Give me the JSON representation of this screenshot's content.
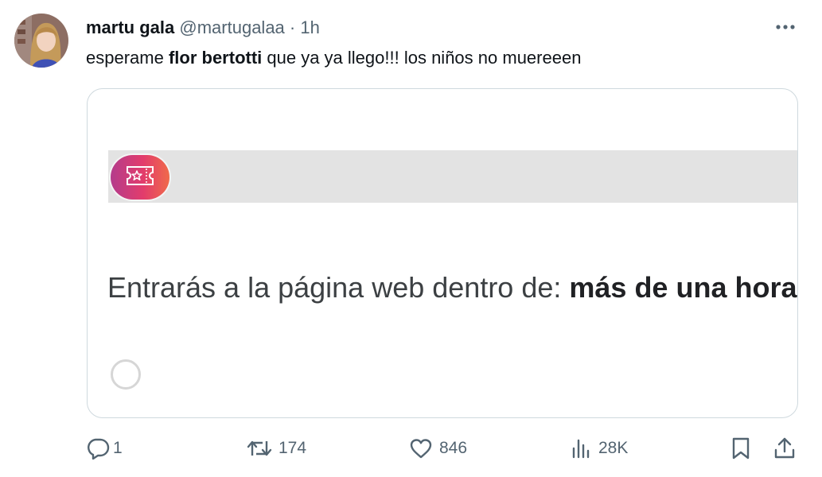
{
  "tweet": {
    "author_name": "martu gala",
    "author_handle": "@martugalaa",
    "separator": "·",
    "time": "1h",
    "text_before": "esperame ",
    "text_mention": "flor bertotti",
    "text_after": " que ya ya llego!!! los niños no muereeen"
  },
  "card": {
    "message_prefix": "Entrarás a la página web dentro de: ",
    "message_value": "más de una hora"
  },
  "actions": {
    "reply_count": "1",
    "retweet_count": "174",
    "like_count": "846",
    "views_count": "28K"
  },
  "icons": {
    "more": "more-icon",
    "reply": "reply-icon",
    "retweet": "retweet-icon",
    "like": "heart-icon",
    "views": "views-icon",
    "bookmark": "bookmark-icon",
    "share": "share-icon",
    "ticket": "ticket-icon"
  },
  "colors": {
    "text_primary": "#0f1419",
    "text_secondary": "#536471",
    "card_border": "#cfd9de",
    "card_bar": "#e3e3e3",
    "logo_gradient_start": "#b43c8c",
    "logo_gradient_end": "#f06a4a"
  }
}
